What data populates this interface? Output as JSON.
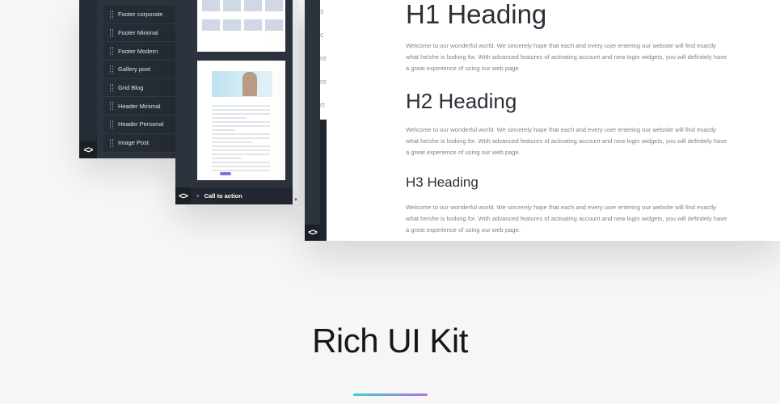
{
  "panel1": {
    "toggle_icon": "code-icon",
    "toggle_glyph": "<>",
    "items": [
      {
        "label": "Footer corporate"
      },
      {
        "label": "Footer Minimal"
      },
      {
        "label": "Footer Modern"
      },
      {
        "label": "Gallery post"
      },
      {
        "label": "Grid Blog"
      },
      {
        "label": "Header Minimal"
      },
      {
        "label": "Header Personal"
      },
      {
        "label": "Image Post"
      }
    ]
  },
  "panel2": {
    "toggle_glyph": "<>",
    "bottom_item_label": "Call to action"
  },
  "panel3": {
    "toggle_glyph": "<>",
    "side_fragments": [
      "s c",
      "re",
      "re",
      "rt",
      "re"
    ],
    "h1": "H1 Heading",
    "p1": "Welcome to our wonderful world. We sincerely hope that each and every user entering our website will find exactly what he/she is looking for. With advanced features of activating account and new login widgets, you will definitely have a great experience of using our web page.",
    "h2": "H2 Heading",
    "p2": "Welcome to our wonderful world. We sincerely hope that each and every user entering our website will find exactly what he/she is looking for. With advanced features of activating account and new login widgets, you will definitely have a great experience of using our web page.",
    "h3": "H3 Heading",
    "p3": "Welcome to our wonderful world. We sincerely hope that each and every user entering our website will find exactly what he/she is looking for. With advanced features of activating account and new login widgets, you will definitely have a great experience of using our web page."
  },
  "section": {
    "title": "Rich UI Kit"
  },
  "colors": {
    "divider_start": "#3fd0c6",
    "divider_end": "#b46fe3",
    "panel_dark": "#2c333d"
  }
}
